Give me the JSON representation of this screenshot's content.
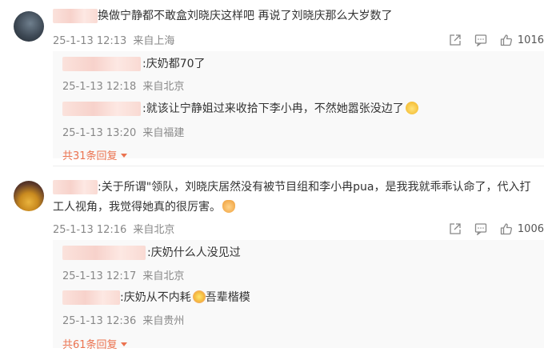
{
  "comments": [
    {
      "text": "换做宁静都不敢盒刘晓庆这样吧 再说了刘晓庆那么大岁数了",
      "date": "25-1-13 12:13",
      "location": "来自上海",
      "like_count": "1016",
      "replies": [
        {
          "text": ":庆奶都70了",
          "date": "25-1-13 12:18",
          "location": "来自北京"
        },
        {
          "text": ":就该让宁静姐过来收拾下李小冉，不然她嚣张没边了",
          "date": "25-1-13 13:20",
          "location": "来自福建",
          "emoji": "cat-emoji"
        }
      ],
      "more_replies": "共31条回复"
    },
    {
      "text_line1": ":关于所谓\"领队，刘晓庆居然没有被节目组和李小冉pua，是我我就乖乖认命了，代入打",
      "text_line2": "工人视角，我觉得她真的很厉害。",
      "emoji": "thumbs-up-emoji",
      "date": "25-1-13 12:16",
      "location": "来自北京",
      "like_count": "1006",
      "replies": [
        {
          "text": ":庆奶什么人没见过",
          "date": "25-1-13 12:17",
          "location": "来自北京"
        },
        {
          "text_a": ":庆奶从不内耗",
          "text_b": "吾辈楷模",
          "date": "25-1-13 12:36",
          "location": "来自贵州",
          "emoji": "flower-emoji"
        }
      ],
      "more_replies": "共61条回复"
    }
  ],
  "colors": {
    "accent": "#eb7350",
    "meta": "#888888",
    "text": "#333333",
    "reply_bg": "#f9f9f9"
  }
}
